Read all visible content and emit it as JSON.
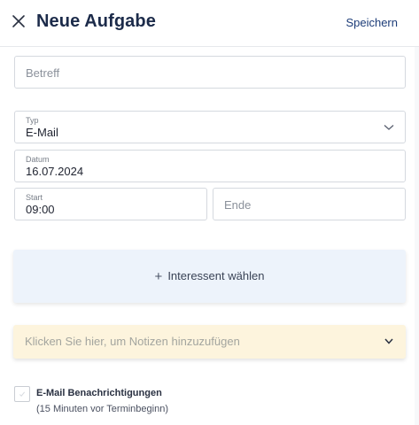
{
  "header": {
    "title": "Neue Aufgabe",
    "save_label": "Speichern",
    "close_icon": "close-icon"
  },
  "form": {
    "subject": {
      "placeholder": "Betreff",
      "value": ""
    },
    "type": {
      "label": "Typ",
      "value": "E-Mail"
    },
    "date": {
      "label": "Datum",
      "value": "16.07.2024"
    },
    "start": {
      "label": "Start",
      "value": "09:00"
    },
    "end": {
      "placeholder": "Ende",
      "value": ""
    }
  },
  "interessent": {
    "label": "Interessent wählen",
    "icon": "plus-icon"
  },
  "notes": {
    "placeholder": "Klicken Sie hier, um Notizen hinzuzufügen"
  },
  "notifications": {
    "label": "E-Mail Benachrichtigungen",
    "sublabel": "(15 Minuten vor Terminbeginn)",
    "checked": false
  },
  "colors": {
    "title": "#1c2b4a",
    "save": "#1c3c78",
    "interessent_bg": "#edf3fb",
    "notes_bg": "#fdf4dd"
  }
}
